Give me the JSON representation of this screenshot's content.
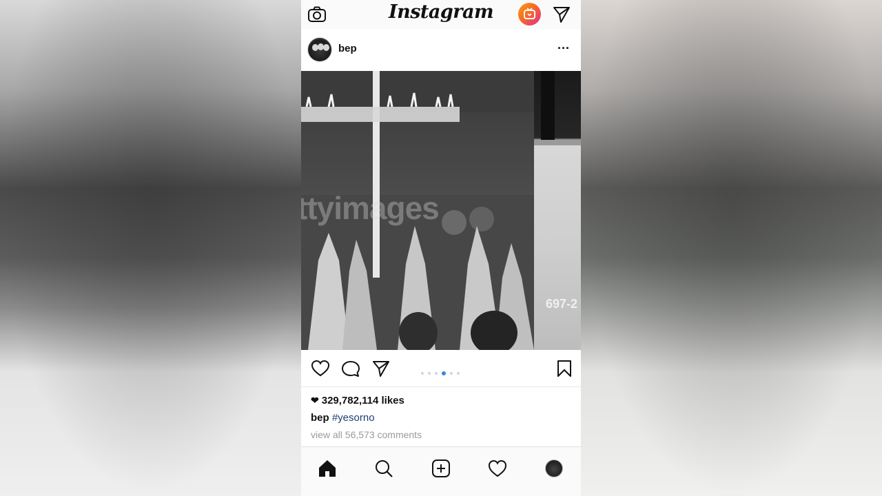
{
  "app": {
    "logo_text": "Instagram"
  },
  "post": {
    "username": "bep",
    "more_label": "···",
    "media": {
      "watermark_text": "ttyimages",
      "side_code": "697-2"
    },
    "carousel": {
      "count": 6,
      "active_index": 3
    },
    "likes_count": "329,782,114 likes",
    "caption_username": "bep",
    "caption_hashtag": "#yesorno",
    "comments_link": "view all 56,573 comments"
  },
  "icons": {
    "top": [
      "camera-icon",
      "igtv-icon",
      "direct-message-icon"
    ],
    "actions": [
      "like-heart-icon",
      "comment-icon",
      "share-icon",
      "bookmark-icon"
    ],
    "nav": [
      "home-icon",
      "search-icon",
      "new-post-icon",
      "activity-heart-icon",
      "profile-avatar-icon"
    ]
  },
  "colors": {
    "hashtag": "#1d3d72",
    "carousel_active": "#3a88d6",
    "comments_text": "#9a9a9a"
  }
}
